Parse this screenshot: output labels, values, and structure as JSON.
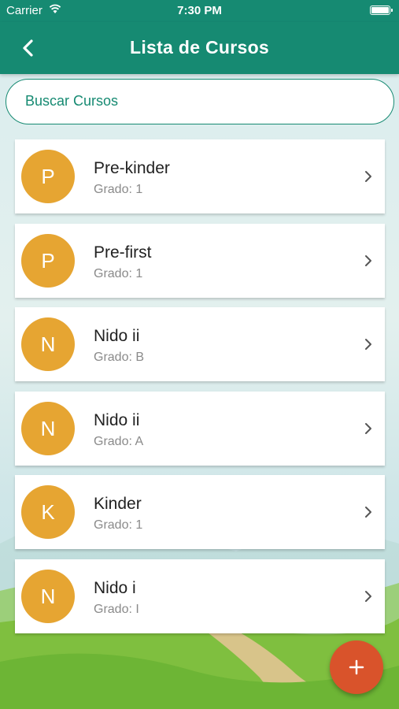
{
  "status_bar": {
    "carrier": "Carrier",
    "time": "7:30 PM",
    "icons": [
      "wifi-icon",
      "battery-icon"
    ]
  },
  "nav": {
    "title": "Lista de Cursos",
    "back_icon": "chevron-left-icon"
  },
  "search": {
    "placeholder": "Buscar Cursos",
    "value": ""
  },
  "courses": [
    {
      "initial": "P",
      "name": "Pre-kinder",
      "grade": "Grado: 1"
    },
    {
      "initial": "P",
      "name": "Pre-first",
      "grade": "Grado: 1"
    },
    {
      "initial": "N",
      "name": "Nido ii",
      "grade": "Grado: B"
    },
    {
      "initial": "N",
      "name": "Nido ii",
      "grade": "Grado: A"
    },
    {
      "initial": "K",
      "name": "Kinder",
      "grade": "Grado: 1"
    },
    {
      "initial": "N",
      "name": "Nido i",
      "grade": "Grado: I"
    }
  ],
  "fab": {
    "icon": "plus-icon"
  },
  "colors": {
    "primary": "#168a72",
    "avatar": "#e6a532",
    "fab": "#d9532b",
    "text": "#222222",
    "subtext": "#8a8a8a"
  }
}
